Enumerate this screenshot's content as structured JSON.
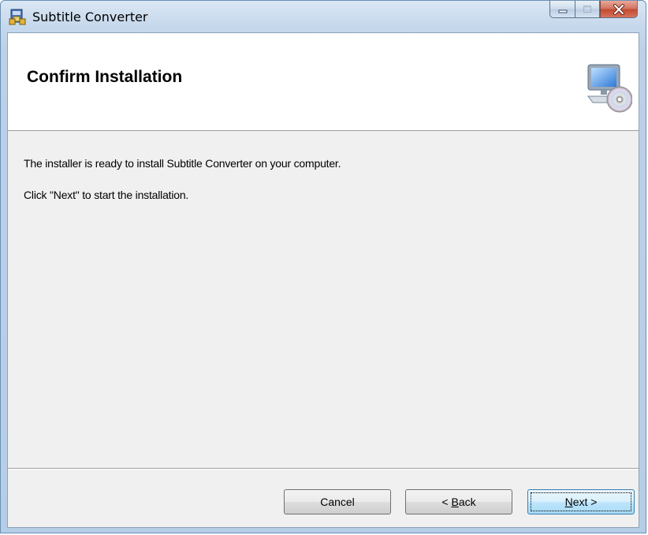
{
  "window": {
    "title": "Subtitle Converter",
    "icon": "installer-package-icon",
    "controls": {
      "minimize": "minimize-icon",
      "maximize": "maximize-icon",
      "close": "close-icon"
    }
  },
  "banner": {
    "title": "Confirm Installation",
    "image": "computer-cd-icon"
  },
  "content": {
    "line1": "The installer is ready to install Subtitle Converter on your computer.",
    "line2": "Click \"Next\" to start the installation."
  },
  "buttons": {
    "cancel": "Cancel",
    "back_prefix": "< ",
    "back_mnemonic": "B",
    "back_rest": "ack",
    "next_mnemonic": "N",
    "next_rest": "ext >"
  },
  "colors": {
    "frame": "#bcd1e8",
    "client_bg": "#f0f0f0",
    "banner_bg": "#ffffff",
    "close_button": "#c24a30",
    "default_button_border": "#3c7fb1"
  }
}
